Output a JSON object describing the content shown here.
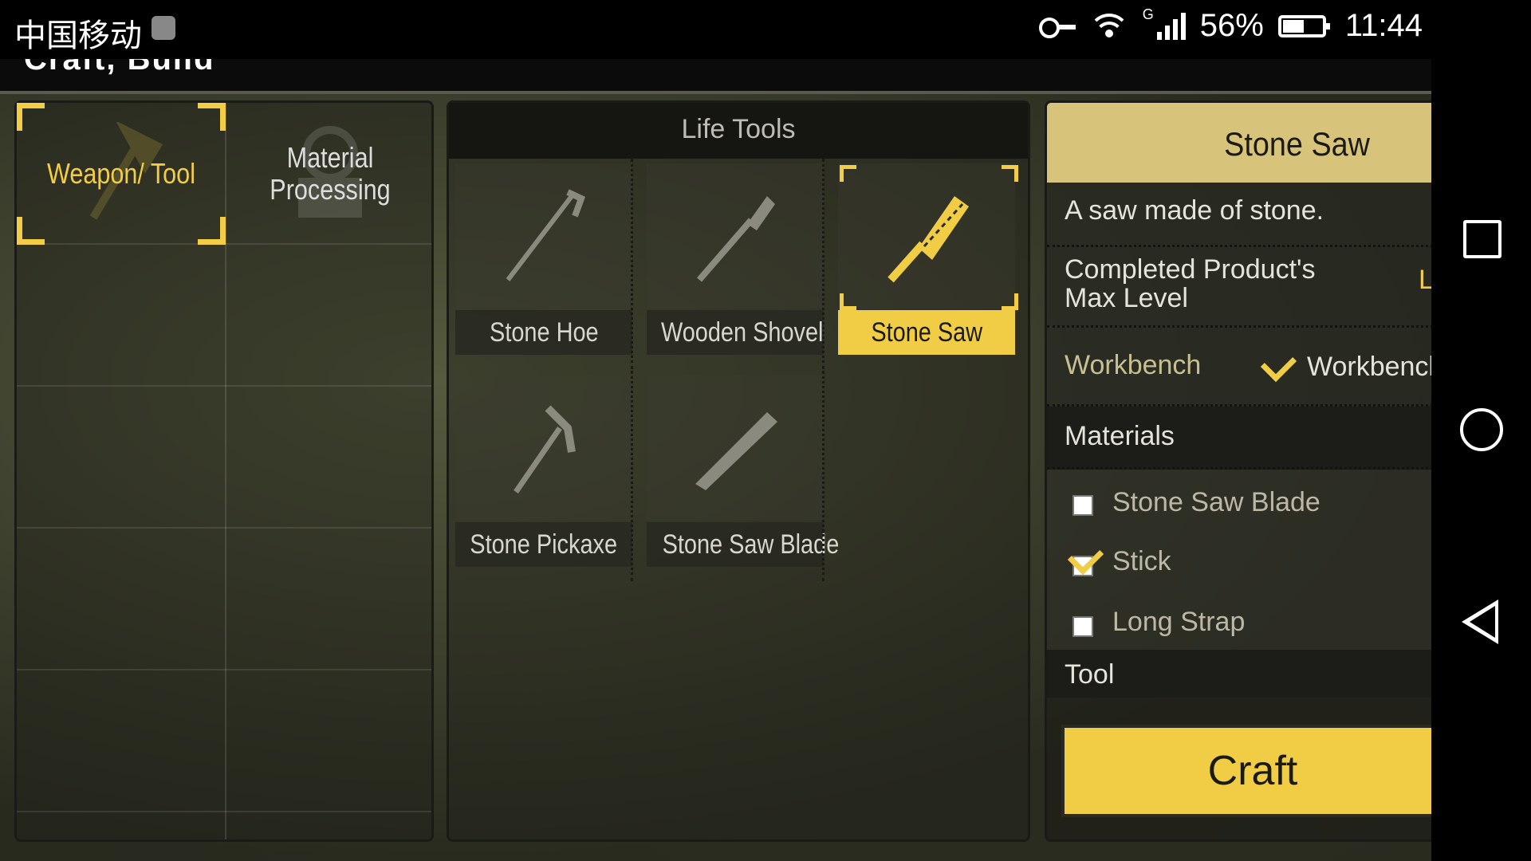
{
  "status_bar": {
    "carrier": "中国移动",
    "network_type": "G",
    "battery": "56%",
    "time": "11:44"
  },
  "header": {
    "title": "Craft, Build"
  },
  "categories": [
    {
      "label": "Weapon/ Tool",
      "selected": true
    },
    {
      "label": "Material Processing",
      "selected": false
    }
  ],
  "items_panel": {
    "title": "Life Tools",
    "items": [
      {
        "name": "Stone Hoe",
        "icon": "hoe-icon",
        "selected": false
      },
      {
        "name": "Wooden Shovel",
        "icon": "shovel-icon",
        "selected": false
      },
      {
        "name": "Stone Saw",
        "icon": "saw-icon",
        "selected": true
      },
      {
        "name": "Stone Pickaxe",
        "icon": "pickaxe-icon",
        "selected": false
      },
      {
        "name": "Stone Saw Blade",
        "icon": "saw-blade-icon",
        "selected": false
      }
    ]
  },
  "details": {
    "name": "Stone Saw",
    "description": "A saw made of stone.",
    "max_level_label": "Completed Product's Max Level",
    "max_level_value": "L",
    "workbench_label": "Workbench",
    "workbench_value": "Workbench",
    "materials_header": "Materials",
    "materials": [
      {
        "name": "Stone Saw Blade",
        "have": false
      },
      {
        "name": "Stick",
        "have": true
      },
      {
        "name": "Long Strap",
        "have": false
      }
    ],
    "tool_header": "Tool",
    "craft_label": "Craft"
  },
  "colors": {
    "accent": "#f1cd45",
    "panel": "#1e2019"
  }
}
